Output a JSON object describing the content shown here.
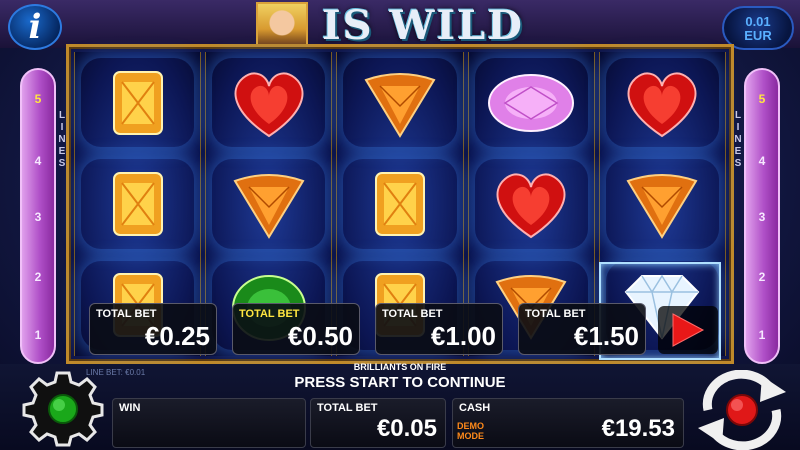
{
  "header": {
    "info_label": "i",
    "title": "IS WILD",
    "denomination_value": "0.01",
    "denomination_currency": "EUR"
  },
  "reels": [
    [
      "orange-square-gem",
      "orange-square-gem",
      "orange-square-gem"
    ],
    [
      "red-heart-gem",
      "orange-triangle-gem",
      "green-round-gem"
    ],
    [
      "orange-triangle-gem",
      "orange-square-gem",
      "orange-square-gem"
    ],
    [
      "pink-oval-gem",
      "red-heart-gem",
      "orange-triangle-gem"
    ],
    [
      "red-heart-gem",
      "orange-triangle-gem",
      "white-diamond"
    ]
  ],
  "lines_panel": {
    "word": "LINES",
    "numbers": [
      "5",
      "4",
      "3",
      "2",
      "1"
    ],
    "active": "5"
  },
  "bet_options": [
    {
      "label": "TOTAL BET",
      "value": "€0.25",
      "selected": false
    },
    {
      "label": "TOTAL BET",
      "value": "€0.50",
      "selected": true
    },
    {
      "label": "TOTAL BET",
      "value": "€1.00",
      "selected": false
    },
    {
      "label": "TOTAL BET",
      "value": "€1.50",
      "selected": false
    }
  ],
  "status": {
    "game_name": "BRILLIANTS ON FIRE",
    "line_bet": "LINE BET: €0.01",
    "message": "PRESS START TO CONTINUE"
  },
  "bottom": {
    "win_label": "WIN",
    "win_value": "",
    "total_bet_label": "TOTAL BET",
    "total_bet_value": "€0.05",
    "cash_label": "CASH",
    "demo_label": "DEMO MODE",
    "cash_value": "€19.53"
  },
  "colors": {
    "accent_yellow": "#ffe640",
    "lines_panel": "#b050c8",
    "frame_gold": "#c08a2a",
    "play_red": "#e81818"
  },
  "icons": [
    "info-icon",
    "settings-gear-icon",
    "play-icon",
    "autospin-arrows-icon"
  ]
}
